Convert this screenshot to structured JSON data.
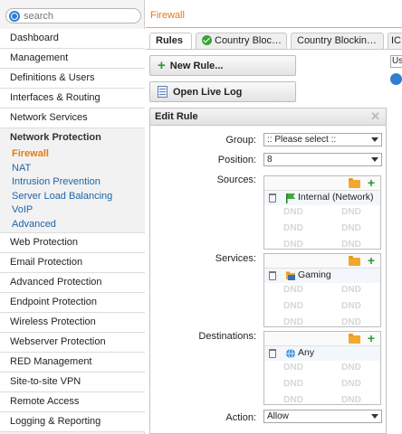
{
  "sidebar": {
    "search_placeholder": "search",
    "items_top": [
      {
        "label": "Dashboard",
        "name": "dashboard"
      },
      {
        "label": "Management",
        "name": "management"
      },
      {
        "label": "Definitions & Users",
        "name": "definitions-users"
      },
      {
        "label": "Interfaces & Routing",
        "name": "interfaces-routing"
      },
      {
        "label": "Network Services",
        "name": "network-services"
      }
    ],
    "active_group": "Network Protection",
    "sub_items": [
      {
        "label": "Firewall",
        "current": true
      },
      {
        "label": "NAT"
      },
      {
        "label": "Intrusion Prevention"
      },
      {
        "label": "Server Load Balancing"
      },
      {
        "label": "VoIP"
      },
      {
        "label": "Advanced"
      }
    ],
    "items_bottom": [
      "Web Protection",
      "Email Protection",
      "Advanced Protection",
      "Endpoint Protection",
      "Wireless Protection",
      "Webserver Protection",
      "RED Management",
      "Site-to-site VPN",
      "Remote Access",
      "Logging & Reporting"
    ]
  },
  "main": {
    "page_title": "Firewall",
    "tabs": [
      {
        "label": "Rules",
        "active": true
      },
      {
        "label": "Country Bloc…",
        "icon": "check-circle-icon"
      },
      {
        "label": "Country Blockin…"
      },
      {
        "label": "IC"
      }
    ],
    "new_rule_label": "New Rule...",
    "open_live_log_label": "Open Live Log",
    "right_stub_select": "Us"
  },
  "edit_rule": {
    "title": "Edit Rule",
    "group_label": "Group:",
    "group_value": ":: Please select ::",
    "position_label": "Position:",
    "position_value": "8",
    "sources_label": "Sources:",
    "sources_item": "Internal (Network)",
    "services_label": "Services:",
    "services_item": "Gaming",
    "destinations_label": "Destinations:",
    "destinations_item": "Any",
    "action_label": "Action:",
    "action_value": "Allow",
    "dnd_text": "DND"
  },
  "colors": {
    "accent_orange": "#e37c14",
    "link_blue": "#2065a8",
    "add_green": "#2d9a2d"
  }
}
